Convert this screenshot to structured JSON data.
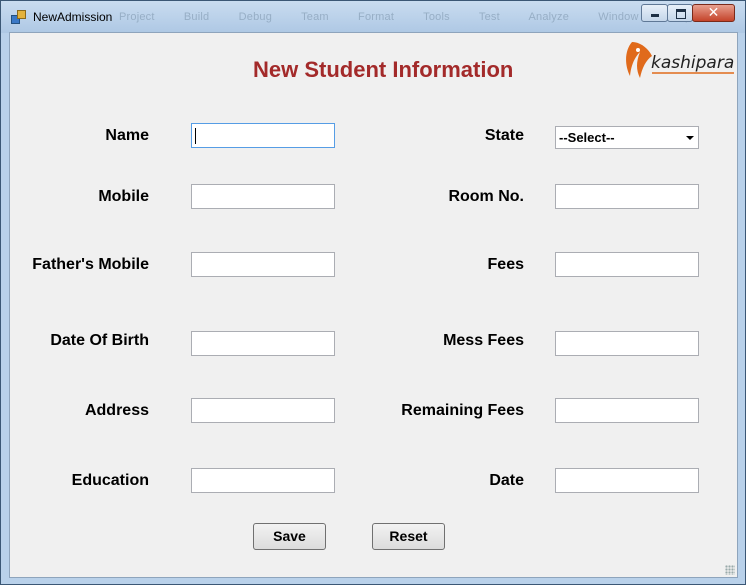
{
  "window": {
    "title": "NewAdmission",
    "ghost_menu": "Project Build Debug Team Format Tools Test Analyze Window Help",
    "close_glyph": "✕"
  },
  "form": {
    "heading": "New Student Information",
    "left": [
      {
        "label": "Name",
        "value": ""
      },
      {
        "label": "Mobile",
        "value": ""
      },
      {
        "label": "Father's Mobile",
        "value": ""
      },
      {
        "label": "Date Of Birth",
        "value": ""
      },
      {
        "label": "Address",
        "value": ""
      },
      {
        "label": "Education",
        "value": ""
      }
    ],
    "right": {
      "state_label": "State",
      "state_selected": "--Select--",
      "fields": [
        {
          "label": "Room No.",
          "value": ""
        },
        {
          "label": "Fees",
          "value": ""
        },
        {
          "label": "Mess Fees",
          "value": ""
        },
        {
          "label": "Remaining Fees",
          "value": ""
        },
        {
          "label": "Date",
          "value": ""
        }
      ]
    },
    "buttons": {
      "save": "Save",
      "reset": "Reset"
    }
  },
  "logo": {
    "text": "kashipara",
    "accent": "#e06a1b"
  },
  "colors": {
    "heading": "#a32a2a",
    "titlebar": "#b9d1ea",
    "form_bg": "#f0f0f0"
  }
}
